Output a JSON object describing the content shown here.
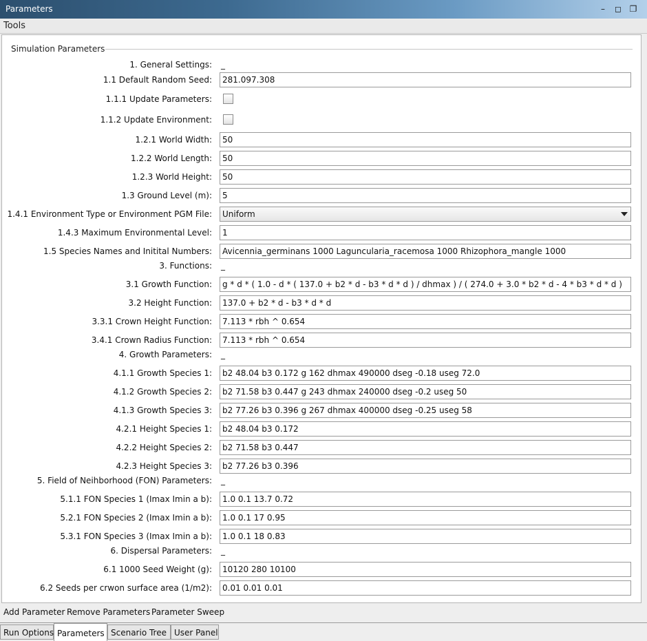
{
  "window": {
    "title": "Parameters",
    "controls": [
      "minimize-icon",
      "maximize-icon",
      "restore-icon"
    ]
  },
  "menu": {
    "tools": "Tools"
  },
  "group": {
    "title": "Simulation Parameters"
  },
  "rows": [
    {
      "label": "1. General Settings:",
      "kind": "header",
      "value": "_"
    },
    {
      "label": "1.1 Default Random Seed:",
      "kind": "text",
      "value": "281.097.308"
    },
    {
      "label": "1.1.1 Update Parameters:",
      "kind": "checkbox",
      "checked": false
    },
    {
      "label": "1.1.2 Update Environment:",
      "kind": "checkbox",
      "checked": false
    },
    {
      "label": "1.2.1 World Width:",
      "kind": "text",
      "value": "50"
    },
    {
      "label": "1.2.2 World Length:",
      "kind": "text",
      "value": "50"
    },
    {
      "label": "1.2.3 World Height:",
      "kind": "text",
      "value": "50"
    },
    {
      "label": "1.3 Ground Level (m):",
      "kind": "text",
      "value": "5"
    },
    {
      "label": "1.4.1 Environment Type or Environment PGM File:",
      "kind": "combo",
      "value": "Uniform"
    },
    {
      "label": "1.4.3 Maximum Environmental Level:",
      "kind": "text",
      "value": "1"
    },
    {
      "label": "1.5 Species Names and Initital Numbers:",
      "kind": "text",
      "value": "Avicennia_germinans 1000 Laguncularia_racemosa 1000 Rhizophora_mangle 1000"
    },
    {
      "label": "3. Functions:",
      "kind": "header",
      "value": "_"
    },
    {
      "label": "3.1 Growth Function:",
      "kind": "text",
      "value": "g * d * ( 1.0 - d * ( 137.0 + b2 * d - b3 * d * d ) / dhmax ) / ( 274.0 + 3.0 * b2 * d - 4 * b3 * d * d )"
    },
    {
      "label": "3.2 Height Function:",
      "kind": "text",
      "value": "137.0 + b2 * d - b3 * d * d"
    },
    {
      "label": "3.3.1 Crown Height Function:",
      "kind": "text",
      "value": "7.113 * rbh ^ 0.654"
    },
    {
      "label": "3.4.1 Crown Radius Function:",
      "kind": "text",
      "value": "7.113 * rbh ^ 0.654"
    },
    {
      "label": "4. Growth Parameters:",
      "kind": "header",
      "value": "_"
    },
    {
      "label": "4.1.1 Growth Species 1:",
      "kind": "text",
      "value": "b2 48.04 b3 0.172 g 162 dhmax 490000 dseg -0.18 useg 72.0"
    },
    {
      "label": "4.1.2 Growth Species 2:",
      "kind": "text",
      "value": "b2 71.58 b3 0.447 g 243 dhmax 240000 dseg -0.2 useg 50"
    },
    {
      "label": "4.1.3 Growth Species 3:",
      "kind": "text",
      "value": "b2 77.26 b3 0.396 g 267 dhmax 400000 dseg -0.25 useg 58"
    },
    {
      "label": "4.2.1 Height Species 1:",
      "kind": "text",
      "value": "b2 48.04 b3 0.172"
    },
    {
      "label": "4.2.2 Height Species 2:",
      "kind": "text",
      "value": "b2 71.58 b3 0.447"
    },
    {
      "label": "4.2.3 Height Species 3:",
      "kind": "text",
      "value": "b2 77.26 b3 0.396"
    },
    {
      "label": "5. Field of Neihborhood (FON) Parameters:",
      "kind": "header",
      "value": "_"
    },
    {
      "label": "5.1.1 FON Species 1 (Imax Imin a b):",
      "kind": "text",
      "value": "1.0 0.1 13.7 0.72"
    },
    {
      "label": "5.2.1 FON Species 2 (Imax Imin a b):",
      "kind": "text",
      "value": "1.0 0.1 17 0.95"
    },
    {
      "label": "5.3.1 FON Species 3 (Imax Imin a b):",
      "kind": "text",
      "value": "1.0 0.1 18 0.83"
    },
    {
      "label": "6. Dispersal Parameters:",
      "kind": "header",
      "value": "_"
    },
    {
      "label": "6.1 1000 Seed Weight (g):",
      "kind": "text",
      "value": "10120 280 10100"
    },
    {
      "label": "6.2 Seeds per crwon surface area (1/m2):",
      "kind": "text",
      "value": "0.01 0.01 0.01"
    }
  ],
  "toolbar": {
    "add": "Add Parameter",
    "remove": "Remove Parameters",
    "sweep": "Parameter Sweep"
  },
  "tabs": [
    {
      "label": "Run Options",
      "active": false
    },
    {
      "label": "Parameters",
      "active": true
    },
    {
      "label": "Scenario Tree",
      "active": false
    },
    {
      "label": "User Panel",
      "active": false
    }
  ]
}
